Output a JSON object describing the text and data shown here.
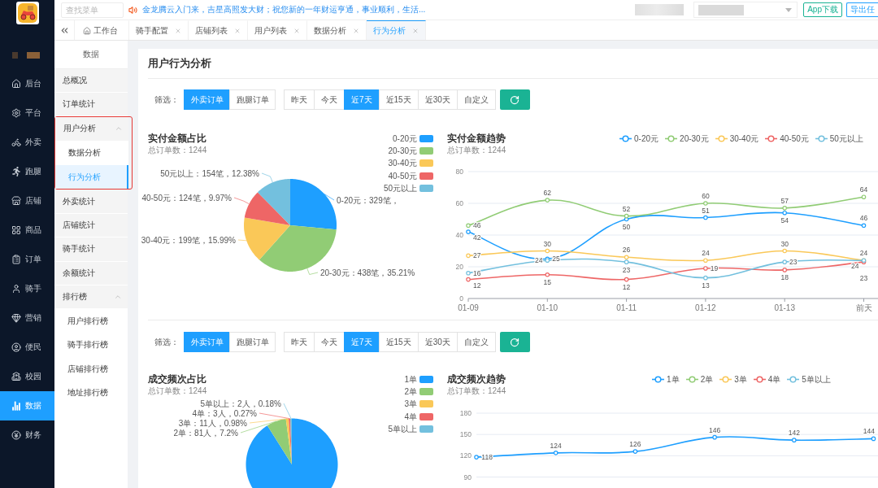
{
  "sidebar": {
    "items": [
      {
        "label": "后台",
        "selected": false
      },
      {
        "label": "平台",
        "selected": false
      },
      {
        "label": "外卖",
        "selected": false
      },
      {
        "label": "跑腿",
        "selected": false
      },
      {
        "label": "店铺",
        "selected": false
      },
      {
        "label": "商品",
        "selected": false
      },
      {
        "label": "订单",
        "selected": false
      },
      {
        "label": "骑手",
        "selected": false
      },
      {
        "label": "营销",
        "selected": false
      },
      {
        "label": "便民",
        "selected": false
      },
      {
        "label": "校园",
        "selected": false
      },
      {
        "label": "数据",
        "selected": true
      },
      {
        "label": "财务",
        "selected": false
      }
    ]
  },
  "top_bar": {
    "search": {
      "placeholder": "查找菜单"
    },
    "notice": "金龙腾云入门来，吉星高照发大财；祝您新的一年财运亨通，事业顺利，生活...",
    "buttons": [
      {
        "label": "App下载",
        "color": "#19b394"
      },
      {
        "label": "导出任",
        "color": "#1e9fff"
      }
    ]
  },
  "tabs": [
    {
      "label": "工作台",
      "kind": "home",
      "selected": false
    },
    {
      "label": "骑手配置",
      "kind": "closable",
      "selected": false
    },
    {
      "label": "店铺列表",
      "kind": "closable",
      "selected": false
    },
    {
      "label": "用户列表",
      "kind": "closable",
      "selected": false
    },
    {
      "label": "数据分析",
      "kind": "closable",
      "selected": false
    },
    {
      "label": "行为分析",
      "kind": "closable",
      "selected": true
    }
  ],
  "submenu": {
    "title": "数据",
    "items": [
      {
        "label": "总概况",
        "kind": "link",
        "selected": false
      },
      {
        "label": "订单统计",
        "kind": "link",
        "selected": false
      },
      {
        "label": "用户分析",
        "kind": "group",
        "expanded": true,
        "outlined": true,
        "children": [
          {
            "label": "数据分析",
            "selected": false
          },
          {
            "label": "行为分析",
            "selected": true
          }
        ]
      },
      {
        "label": "外卖统计",
        "kind": "link",
        "selected": false
      },
      {
        "label": "店铺统计",
        "kind": "link",
        "selected": false
      },
      {
        "label": "骑手统计",
        "kind": "link",
        "selected": false
      },
      {
        "label": "余额统计",
        "kind": "link",
        "selected": false
      },
      {
        "label": "排行榜",
        "kind": "group",
        "expanded": true,
        "outlined": false,
        "children": [
          {
            "label": "用户排行榜",
            "selected": false
          },
          {
            "label": "骑手排行榜",
            "selected": false
          },
          {
            "label": "店铺排行榜",
            "selected": false
          },
          {
            "label": "地址排行榜",
            "selected": false
          }
        ]
      }
    ]
  },
  "page": {
    "title": "用户行为分析",
    "sections": [
      {
        "filter": {
          "label": "筛选：",
          "order_types": [
            {
              "label": "外卖订单",
              "selected": true
            },
            {
              "label": "跑腿订单",
              "selected": false
            }
          ],
          "ranges": [
            {
              "label": "昨天",
              "selected": false
            },
            {
              "label": "今天",
              "selected": false
            },
            {
              "label": "近7天",
              "selected": true
            },
            {
              "label": "近15天",
              "selected": false
            },
            {
              "label": "近30天",
              "selected": false
            },
            {
              "label": "自定义",
              "selected": false
            }
          ]
        },
        "share": {
          "title": "实付金额占比",
          "subtitle": "总订单数：1244",
          "chart_data": {
            "type": "pie",
            "legend": "right",
            "categories": [
              "0-20元",
              "20-30元",
              "30-40元",
              "40-50元",
              "50元以上"
            ],
            "values": [
              329,
              438,
              199,
              124,
              154
            ],
            "colors": [
              "#1e9fff",
              "#91cc75",
              "#fac858",
              "#ee6666",
              "#73c0de"
            ],
            "value_labels": [
              "0-20元：329笔，",
              "20-30元：438笔，35.21%",
              "30-40元：199笔，15.99%",
              "40-50元：124笔，9.97%",
              "50元以上：154笔，12.38%"
            ]
          }
        },
        "trend": {
          "title": "实付金额趋势",
          "subtitle": "总订单数：1244",
          "chart_data": {
            "type": "line",
            "legend": "top",
            "grid": true,
            "categories": [
              "01-09",
              "01-10",
              "01-11",
              "01-12",
              "01-13",
              "前天"
            ],
            "ylim": [
              0,
              80
            ],
            "yticks": [
              0,
              20,
              40,
              60,
              80
            ],
            "data_labels": true,
            "series": [
              {
                "name": "0-20元",
                "color": "#1e9fff",
                "marker": "circle",
                "values": [
                  42,
                  25,
                  50,
                  51,
                  54,
                  46
                ]
              },
              {
                "name": "20-30元",
                "color": "#91cc75",
                "marker": "circle",
                "values": [
                  46,
                  62,
                  52,
                  60,
                  57,
                  64
                ]
              },
              {
                "name": "30-40元",
                "color": "#fac858",
                "marker": "circle",
                "values": [
                  27,
                  30,
                  26,
                  24,
                  30,
                  24
                ]
              },
              {
                "name": "40-50元",
                "color": "#ee6666",
                "marker": "circle",
                "values": [
                  12,
                  15,
                  12,
                  19,
                  18,
                  23
                ]
              },
              {
                "name": "50元以上",
                "color": "#73c0de",
                "marker": "circle",
                "values": [
                  16,
                  24,
                  23,
                  13,
                  23,
                  24
                ]
              }
            ]
          }
        }
      },
      {
        "filter": {
          "label": "筛选：",
          "order_types": [
            {
              "label": "外卖订单",
              "selected": true
            },
            {
              "label": "跑腿订单",
              "selected": false
            }
          ],
          "ranges": [
            {
              "label": "昨天",
              "selected": false
            },
            {
              "label": "今天",
              "selected": false
            },
            {
              "label": "近7天",
              "selected": true
            },
            {
              "label": "近15天",
              "selected": false
            },
            {
              "label": "近30天",
              "selected": false
            },
            {
              "label": "自定义",
              "selected": false
            }
          ]
        },
        "share": {
          "title": "成交频次占比",
          "subtitle": "总订单数：1244",
          "chart_data": {
            "type": "pie",
            "legend": "right",
            "categories": [
              "1单",
              "2单",
              "3单",
              "4单",
              "5单以上"
            ],
            "values": [
              1028,
              81,
              11,
              3,
              2
            ],
            "colors": [
              "#1e9fff",
              "#91cc75",
              "#fac858",
              "#ee6666",
              "#73c0de"
            ],
            "value_labels": [
              null,
              "2单：81人，7.2%",
              "3单：11人，0.98%",
              "4单：3人，0.27%",
              "5单以上：2人，0.18%"
            ]
          }
        },
        "trend": {
          "title": "成交频次趋势",
          "subtitle": "总订单数：1244",
          "chart_data": {
            "type": "line",
            "legend": "top",
            "grid": true,
            "ylim": [
              90,
              180
            ],
            "yticks": [
              90,
              120,
              150,
              180
            ],
            "data_labels": true,
            "series": [
              {
                "name": "1单",
                "color": "#1e9fff",
                "marker": "circle",
                "values": [
                  118,
                  124,
                  126,
                  146,
                  142,
                  144
                ]
              },
              {
                "name": "2单",
                "color": "#91cc75"
              },
              {
                "name": "3单",
                "color": "#fac858"
              },
              {
                "name": "4单",
                "color": "#ee6666"
              },
              {
                "name": "5单以上",
                "color": "#73c0de"
              }
            ]
          }
        }
      }
    ]
  }
}
